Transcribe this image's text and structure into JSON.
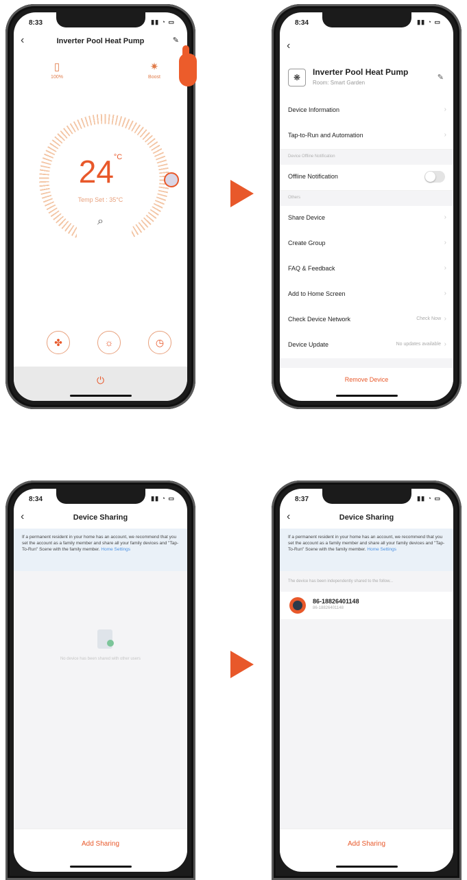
{
  "phone1": {
    "time": "8:33",
    "title": "Inverter Pool Heat Pump",
    "stat_left": {
      "icon": "water-icon",
      "label": "100%"
    },
    "stat_right": {
      "icon": "sun-icon",
      "label": "Boost"
    },
    "temperature": "24",
    "unit": "°C",
    "temp_set": "Temp Set : 35°C",
    "bottom_buttons": [
      "fan-icon",
      "sun-icon",
      "timer-icon"
    ],
    "power_icon": "power-icon",
    "accent": "#e8582a"
  },
  "phone2": {
    "time": "8:34",
    "device_name": "Inverter Pool Heat Pump",
    "device_room": "Room: Smart Garden",
    "rows_a": [
      "Device Information",
      "Tap-to-Run and Automation"
    ],
    "section_offline": "Device Offline Notification",
    "offline_label": "Offline Notification",
    "section_others": "Others",
    "rows_b": [
      "Share Device",
      "Create Group",
      "FAQ & Feedback",
      "Add to Home Screen"
    ],
    "network_label": "Check Device Network",
    "network_value": "Check Now",
    "update_label": "Device Update",
    "update_value": "No updates available",
    "remove": "Remove Device"
  },
  "phone3": {
    "time": "8:34",
    "title": "Device Sharing",
    "notice": "If a permanent resident in your home has an account, we recommend that you set the account as a family member and share all your family devices and \"Tap-To-Run\" Scene with the family member.",
    "notice_link": "Home Settings",
    "empty_text": "No device has been shared with other users",
    "add": "Add Sharing"
  },
  "phone4": {
    "time": "8:37",
    "title": "Device Sharing",
    "notice": "If a permanent resident in your home has an account, we recommend that you set the account as a family member and share all your family devices and \"Tap-To-Run\" Scene with the family member.",
    "notice_link": "Home Settings",
    "shared_note": "The device has been independently shared to the follow...",
    "user_name": "86-18826401148",
    "user_sub": "86-18826401148",
    "add": "Add Sharing"
  }
}
